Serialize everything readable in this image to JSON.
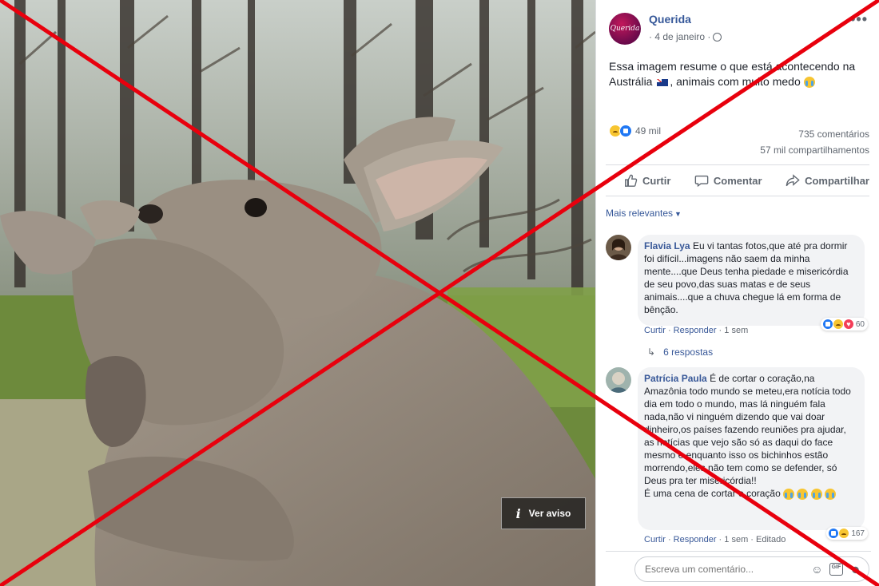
{
  "photo": {
    "warning_button_label": "Ver aviso",
    "info_icon": "i"
  },
  "post": {
    "page_name": "Querida",
    "page_avatar_text": "Querida",
    "date": "· 4 de janeiro ·",
    "privacy_icon": "globe-icon",
    "more_icon": "•••",
    "text_before_flag": "Essa imagem resume o que está acontecendo na Austrália",
    "text_after_flag": ", animais com muito medo",
    "reaction_count": "49 mil",
    "comments_count": "735 comentários",
    "shares_count": "57 mil compartilhamentos",
    "actions": {
      "like": "Curtir",
      "comment": "Comentar",
      "share": "Compartilhar"
    },
    "sort_label": "Mais relevantes"
  },
  "comments": [
    {
      "author": "Flavia Lya",
      "text": "Eu vi tantas fotos,que até pra dormir foi difícil...imagens não saem da minha mente....que Deus tenha piedade e misericórdia de seu povo,das suas matas e de seus animais....que a chuva chegue lá em forma de bênção.",
      "meta_like": "Curtir",
      "meta_reply": "Responder",
      "meta_time": "1 sem",
      "reaction_count": "60",
      "replies": "6 respostas"
    },
    {
      "author": "Patrícia Paula",
      "text": "É de cortar o coração,na Amazônia todo mundo se meteu,era notícia todo dia em todo o mundo, mas lá ninguém fala nada,não vi ninguém dizendo que vai doar dinheiro,os países fazendo reuniões pra ajudar, as notícias que vejo são só as daqui do face mesmo e enquanto isso os bichinhos estão morrendo,eles não tem como se defender, só Deus pra ter misericórdia!!",
      "text_line2": "É uma cena de cortar o coração",
      "meta_like": "Curtir",
      "meta_reply": "Responder",
      "meta_time": "1 sem",
      "meta_edited": "Editado",
      "reaction_count": "167"
    }
  ],
  "composer": {
    "placeholder": "Escreva um comentário..."
  },
  "colors": {
    "facebook_link": "#365899",
    "overlay_x": "#e8000d",
    "like_blue": "#2078f4",
    "sad_yellow": "#f7c531"
  }
}
